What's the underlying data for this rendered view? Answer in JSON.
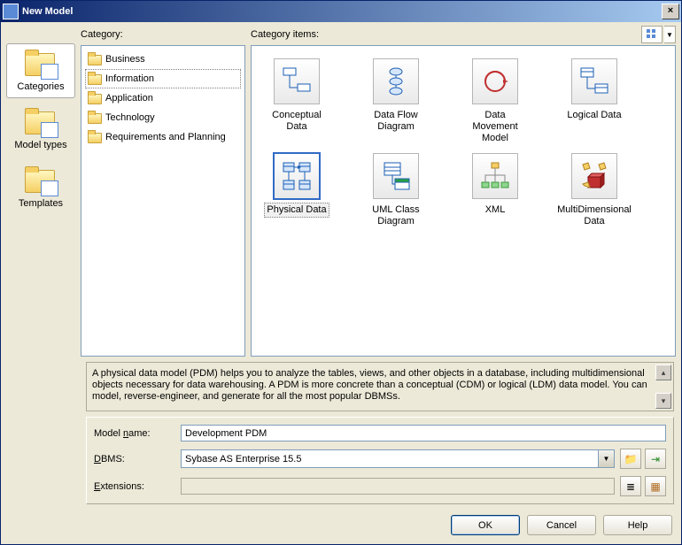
{
  "title": "New Model",
  "sidebar": {
    "items": [
      {
        "label": "Categories"
      },
      {
        "label": "Model types"
      },
      {
        "label": "Templates"
      }
    ],
    "selected": 0
  },
  "category": {
    "label": "Category:",
    "items": [
      {
        "label": "Business"
      },
      {
        "label": "Information"
      },
      {
        "label": "Application"
      },
      {
        "label": "Technology"
      },
      {
        "label": "Requirements and Planning"
      }
    ],
    "selected": 1
  },
  "categoryItems": {
    "label": "Category items:",
    "items": [
      {
        "label": "Conceptual Data"
      },
      {
        "label": "Data Flow Diagram"
      },
      {
        "label": "Data Movement Model"
      },
      {
        "label": "Logical Data"
      },
      {
        "label": "Physical Data"
      },
      {
        "label": "UML Class Diagram"
      },
      {
        "label": "XML"
      },
      {
        "label": "MultiDimensional Data"
      }
    ],
    "selected": 4
  },
  "description": "A physical data model (PDM) helps you to analyze the tables, views, and other objects in a database, including multidimensional objects necessary for data warehousing. A PDM is more concrete than a conceptual (CDM) or logical (LDM) data model. You can model, reverse-engineer, and generate for all the most popular DBMSs.",
  "fields": {
    "modelName": {
      "label": "Model name:",
      "underline": "n",
      "value": "Development PDM"
    },
    "dbms": {
      "label": "DBMS:",
      "underline": "D",
      "value": "Sybase AS Enterprise 15.5"
    },
    "extensions": {
      "label": "Extensions:",
      "underline": "E",
      "value": ""
    }
  },
  "buttons": {
    "ok": "OK",
    "cancel": "Cancel",
    "help": "Help"
  }
}
